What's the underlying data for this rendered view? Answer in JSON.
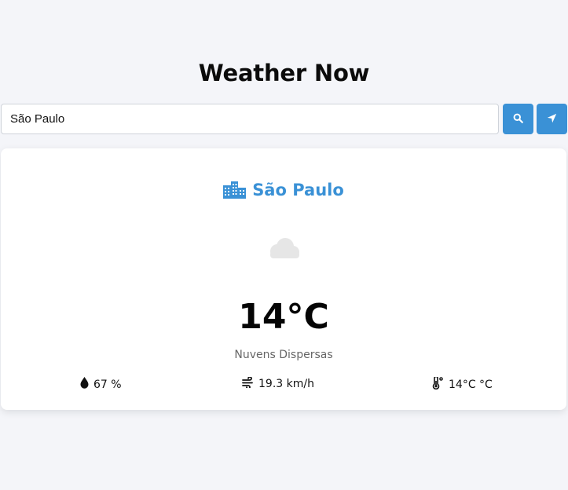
{
  "header": {
    "title": "Weather Now"
  },
  "search": {
    "value": "São Paulo",
    "placeholder": ""
  },
  "buttons": {
    "search_icon": "search-icon",
    "locate_icon": "location-arrow-icon"
  },
  "weather": {
    "city": "São Paulo",
    "city_icon": "city-icon",
    "condition_icon": "cloud-icon",
    "temperature": "14°C",
    "description": "Nuvens Dispersas",
    "humidity": "67 %",
    "wind": "19.3 km/h",
    "feels_like": "14°C °C"
  },
  "colors": {
    "accent": "#3a91d6",
    "background": "#f4f5f9",
    "card": "#ffffff",
    "muted_text": "#666666",
    "cloud": "#e6e6e6"
  }
}
